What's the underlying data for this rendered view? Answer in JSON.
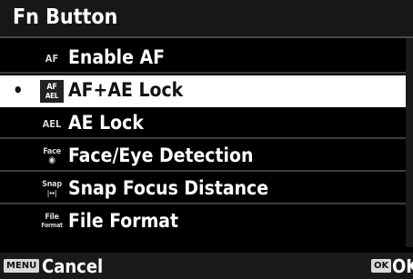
{
  "menu": {
    "title": "Fn Button",
    "items": [
      {
        "label": "Enable AF",
        "icon_text": "AF",
        "icon": "af-icon",
        "selected": false
      },
      {
        "label": "AF+AE Lock",
        "icon_top": "AF",
        "icon_bottom": "AEL",
        "icon": "af-ael-icon",
        "selected": true
      },
      {
        "label": "AE Lock",
        "icon_text": "AEL",
        "icon": "ael-icon",
        "selected": false
      },
      {
        "label": "Face/Eye Detection",
        "icon_top": "Face",
        "icon_bottom": "◉",
        "icon": "face-eye-icon",
        "selected": false
      },
      {
        "label": "Snap Focus Distance",
        "icon_top": "Snap",
        "icon_bottom": "|↔|",
        "icon": "snap-focus-icon",
        "selected": false
      },
      {
        "label": "File Format",
        "icon_top": "File",
        "icon_bottom": "Format",
        "icon": "file-format-icon",
        "selected": false
      }
    ],
    "bullet": "•"
  },
  "footer": {
    "menu_key": "MENU",
    "cancel_label": "Cancel",
    "ok_key": "OK",
    "ok_label": "OK"
  },
  "colors": {
    "background": "#000000",
    "selected_row": "#ffffff",
    "text": "#ffffff"
  }
}
